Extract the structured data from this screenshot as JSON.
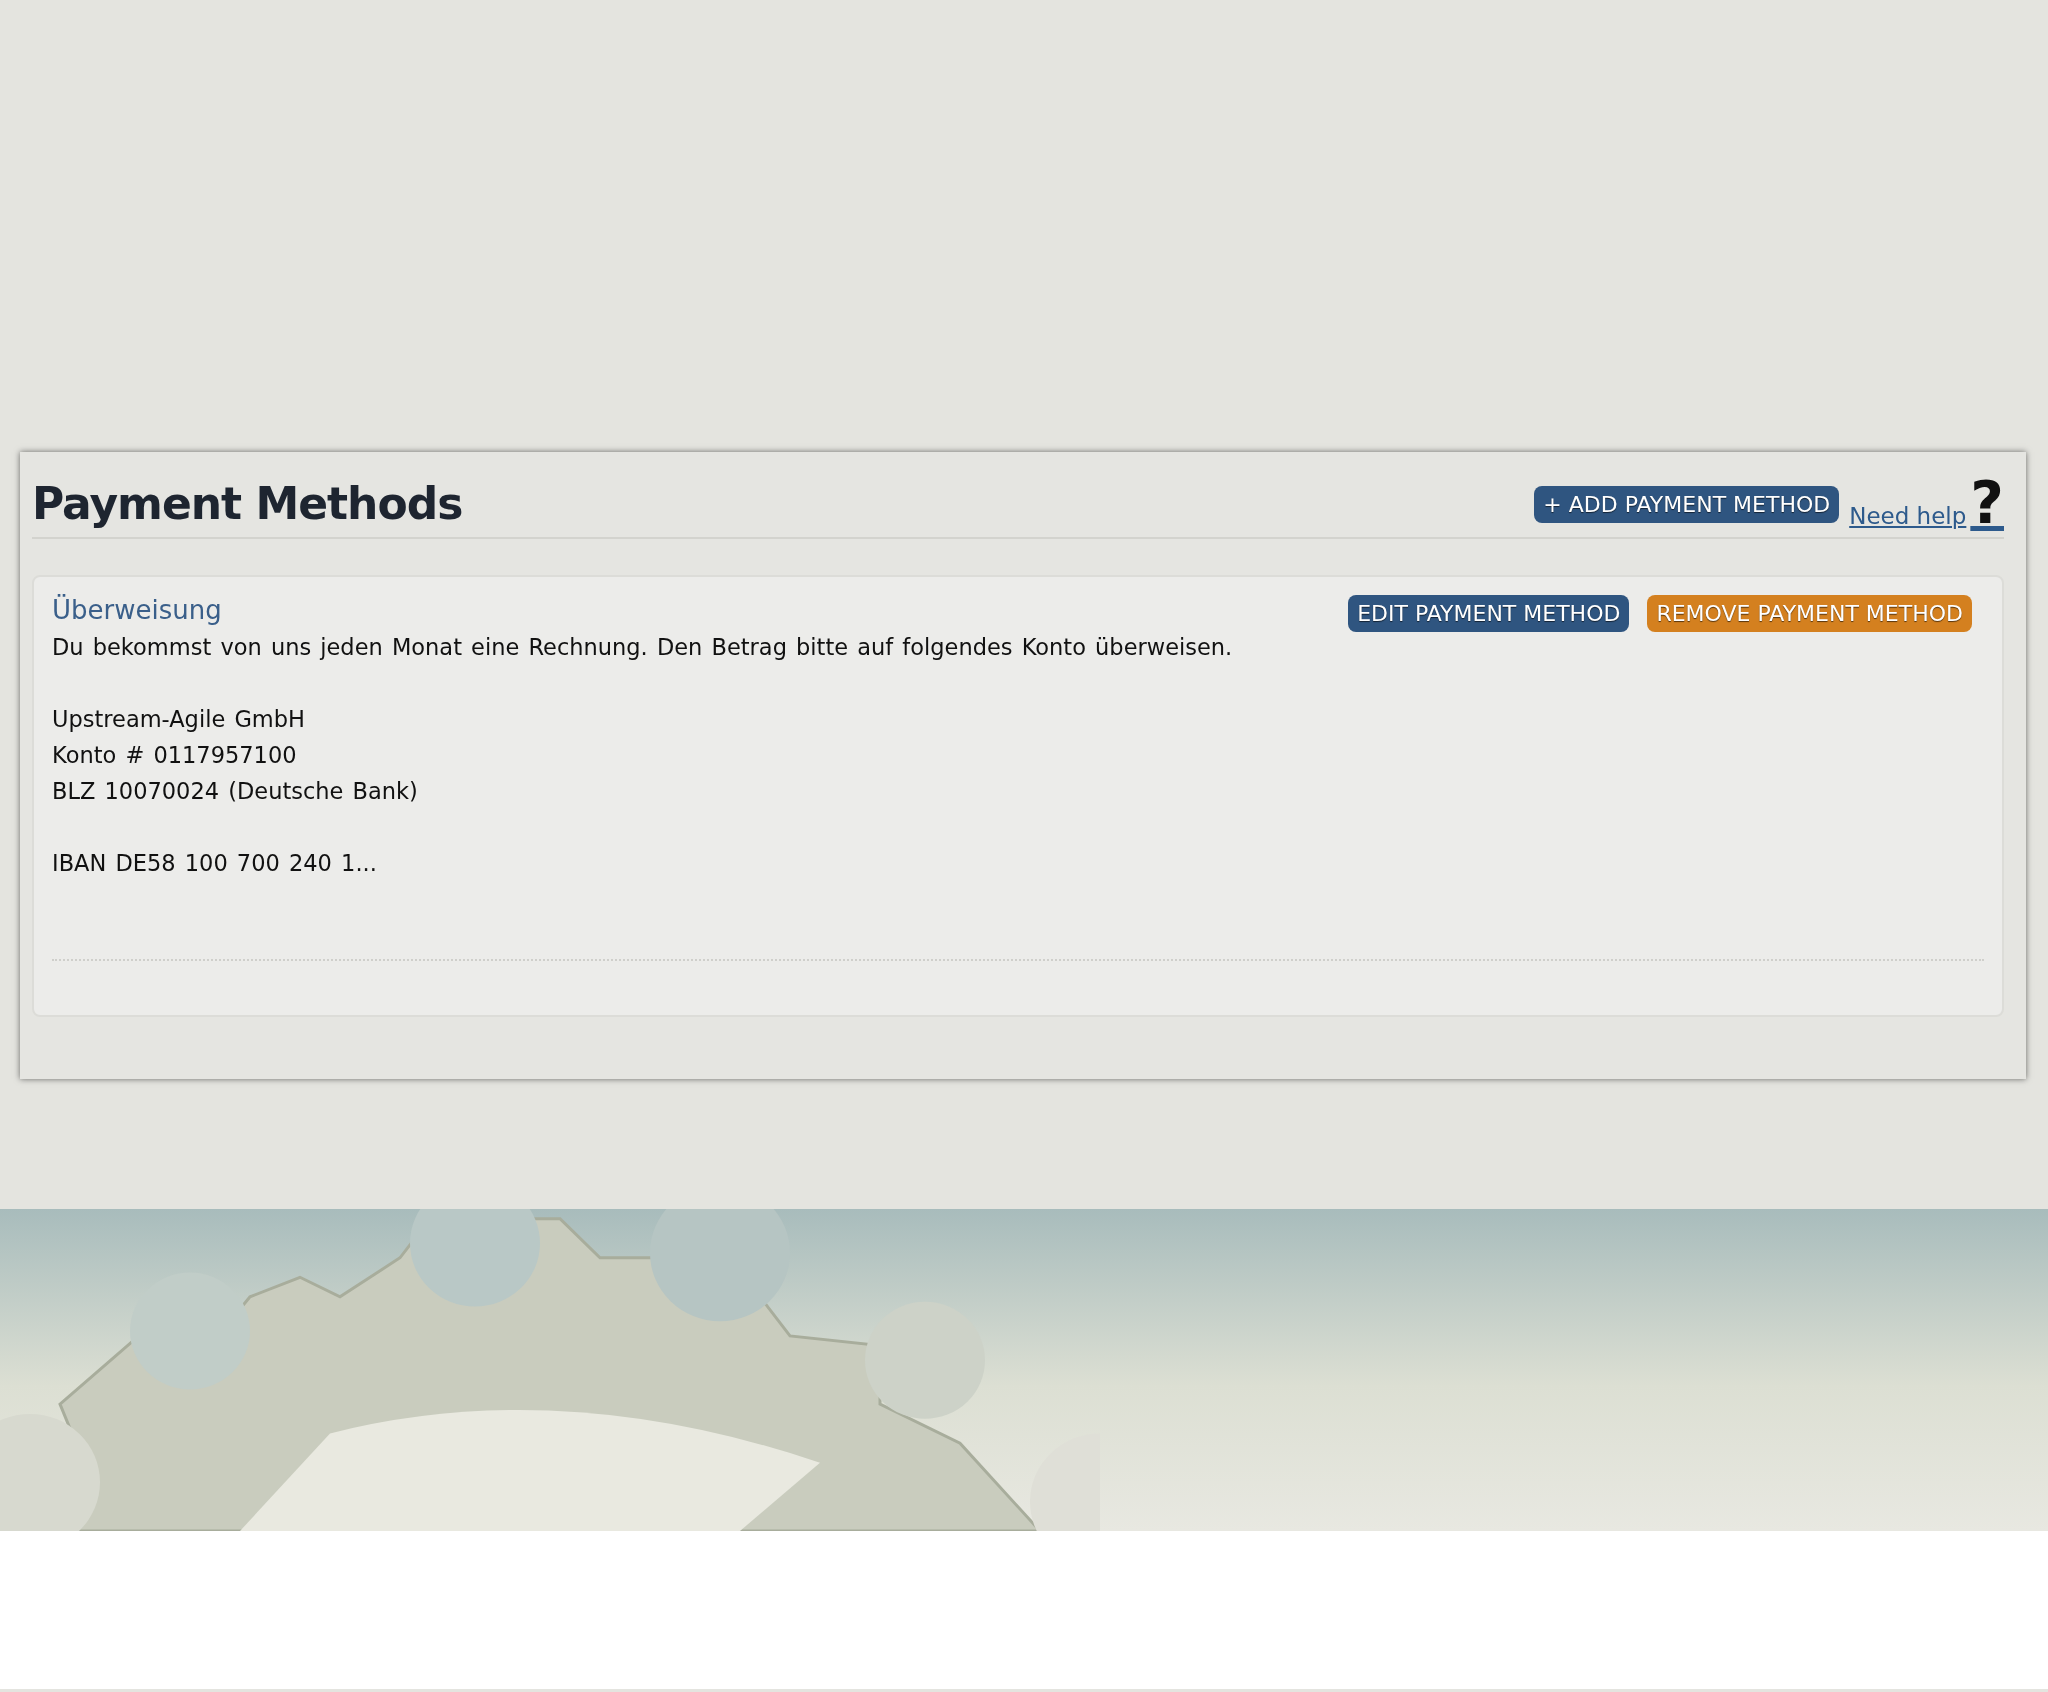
{
  "panel": {
    "title": "Payment Methods",
    "add_button": "+ ADD PAYMENT METHOD",
    "help_link": "Need help",
    "help_mark": "?"
  },
  "payment_methods": [
    {
      "name": "Überweisung",
      "description": "Du bekommst von uns jeden Monat eine Rechnung. Den Betrag bitte auf folgendes Konto überweisen.",
      "detail_groups": [
        [
          "Upstream-Agile GmbH",
          "Konto # 0117957100",
          "BLZ 10070024 (Deutsche Bank)"
        ],
        [
          "IBAN DE58 100 700 240 1..."
        ]
      ],
      "edit_button": "EDIT PAYMENT METHOD",
      "remove_button": "REMOVE PAYMENT METHOD"
    }
  ]
}
